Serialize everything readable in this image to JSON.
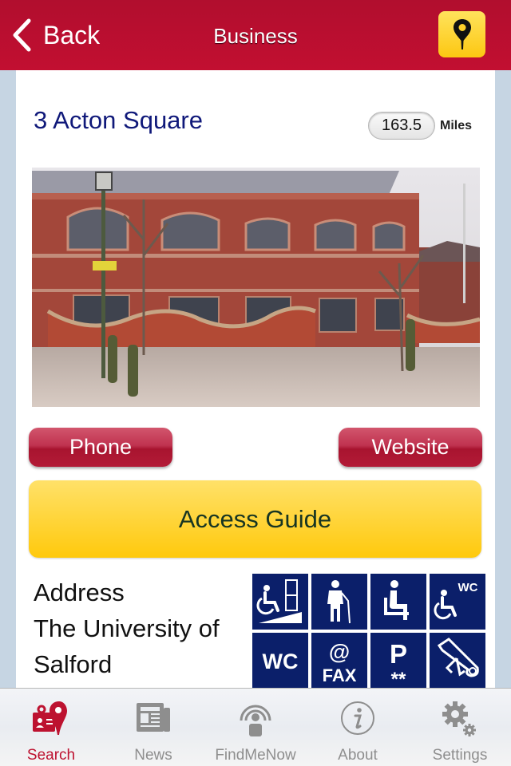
{
  "navbar": {
    "back_label": "Back",
    "title": "Business",
    "map_button_icon": "map-pin-icon"
  },
  "business": {
    "name": "3 Acton Square",
    "distance_value": "163.5",
    "distance_unit": "Miles",
    "photo_description": "Red brick building with arched windows, low curved brick wall, bollards and paved plaza"
  },
  "actions": {
    "phone_label": "Phone",
    "website_label": "Website",
    "access_guide_label": "Access Guide"
  },
  "address": {
    "heading": "Address",
    "lines": [
      "The University of",
      "Salford"
    ]
  },
  "facilities": [
    {
      "icon": "ramp-access-icon",
      "label": "Ramped access"
    },
    {
      "icon": "walking-aid-icon",
      "label": "Walking aid"
    },
    {
      "icon": "seating-icon",
      "label": "Seating"
    },
    {
      "icon": "accessible-wc-icon",
      "label": "Accessible WC",
      "text": "WC"
    },
    {
      "icon": "wc-icon",
      "label": "WC",
      "text": "WC"
    },
    {
      "icon": "email-fax-icon",
      "label": "Email / Fax",
      "text_top": "@",
      "text_bottom": "FAX"
    },
    {
      "icon": "parking-icon",
      "label": "Parking",
      "text_top": "P",
      "text_bottom": "**"
    },
    {
      "icon": "qualification-icon",
      "label": "Certificate"
    }
  ],
  "tabbar": {
    "tabs": [
      {
        "label": "Search",
        "icon": "search-id-pin-icon",
        "active": true
      },
      {
        "label": "News",
        "icon": "news-icon",
        "active": false
      },
      {
        "label": "FindMeNow",
        "icon": "findmenow-icon",
        "active": false
      },
      {
        "label": "About",
        "icon": "info-icon",
        "active": false
      },
      {
        "label": "Settings",
        "icon": "settings-gears-icon",
        "active": false
      }
    ]
  },
  "colors": {
    "brand_red": "#bd1230",
    "accent_yellow": "#ffc90c",
    "icon_navy": "#0b1f6a",
    "title_navy": "#10197a",
    "gutter": "#c6d5e3"
  }
}
